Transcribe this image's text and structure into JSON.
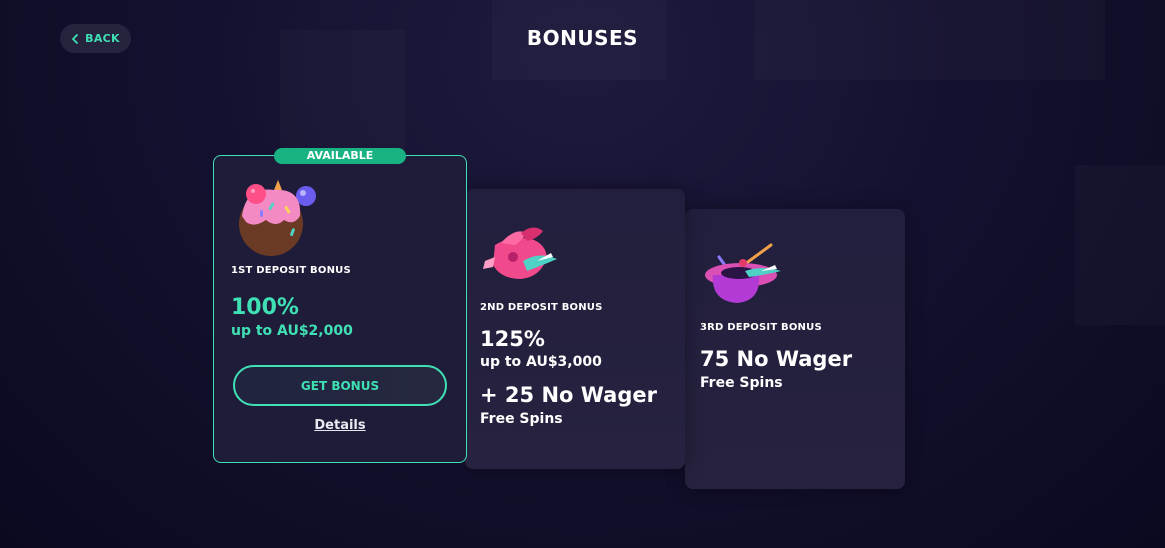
{
  "header": {
    "back_label": "BACK",
    "title": "BONUSES"
  },
  "cards": [
    {
      "badge": "AVAILABLE",
      "label": "1ST DEPOSIT BONUS",
      "amount": "100%",
      "amount_sub": "up to AU$2,000",
      "cta": "GET BONUS",
      "details": "Details",
      "icon": "donut-icon"
    },
    {
      "label": "2ND DEPOSIT BONUS",
      "amount": "125%",
      "amount_sub": "up to AU$3,000",
      "extra": "+ 25 No Wager",
      "extra_sub": "Free Spins",
      "icon": "gift-icon"
    },
    {
      "label": "3RD DEPOSIT BONUS",
      "amount": "75 No Wager",
      "amount_sub": "Free Spins",
      "icon": "magic-hat-icon"
    }
  ],
  "colors": {
    "accent": "#3fe0b4",
    "badge": "#19b383",
    "background": "#141130",
    "card": "#221f3e"
  }
}
